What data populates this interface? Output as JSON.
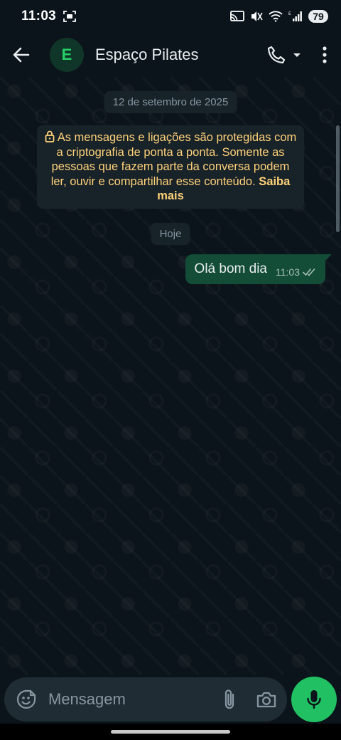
{
  "status_bar": {
    "time": "11:03",
    "battery": "79"
  },
  "header": {
    "avatar_letter": "E",
    "contact_name": "Espaço Pilates",
    "icons": [
      "back-arrow-icon",
      "phone-icon",
      "chevron-down-icon",
      "more-vertical-icon"
    ]
  },
  "chat": {
    "date_label": "12 de setembro de 2025",
    "encryption_notice": "As mensagens e ligações são protegidas com a criptografia de ponta a ponta. Somente as pessoas que fazem parte da conversa podem ler, ouvir e compartilhar esse conteúdo.",
    "learn_more": "Saiba mais",
    "today_label": "Hoje",
    "messages": [
      {
        "text": "Olá bom dia",
        "time": "11:03",
        "status": "read"
      }
    ]
  },
  "composer": {
    "placeholder": "Mensagem",
    "value": ""
  },
  "colors": {
    "background": "#0b141a",
    "outgoing_bubble": "#144d37",
    "accent_green": "#21c063",
    "notice_text": "#ffd279",
    "muted_text": "#8696a0"
  }
}
